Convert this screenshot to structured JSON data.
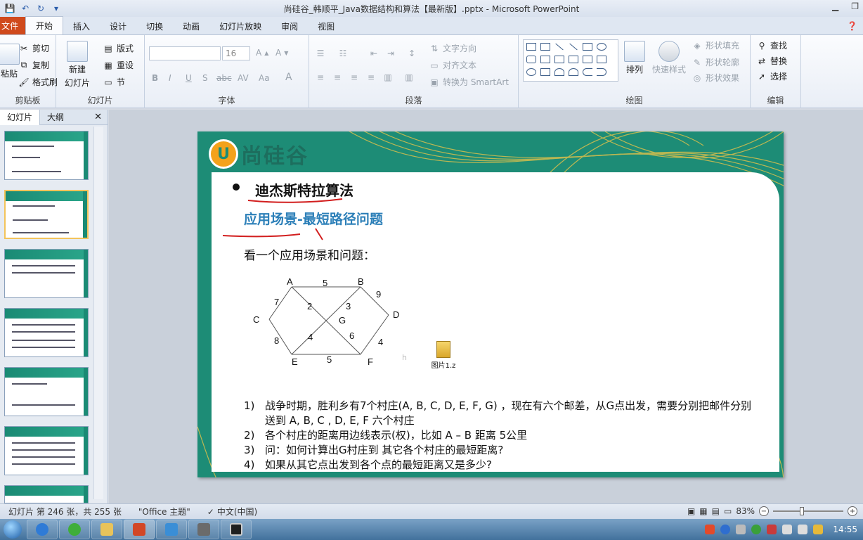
{
  "window": {
    "title": "尚硅谷_韩顺平_Java数据结构和算法【最新版】.pptx - Microsoft PowerPoint"
  },
  "tabs": [
    {
      "label": "文件"
    },
    {
      "label": "开始"
    },
    {
      "label": "插入"
    },
    {
      "label": "设计"
    },
    {
      "label": "切换"
    },
    {
      "label": "动画"
    },
    {
      "label": "幻灯片放映"
    },
    {
      "label": "审阅"
    },
    {
      "label": "视图"
    }
  ],
  "ribbon": {
    "clipboard": {
      "paste": "粘贴",
      "cut": "剪切",
      "copy": "复制",
      "format_painter": "格式刷",
      "label": "剪贴板"
    },
    "slides": {
      "new_slide": "新建",
      "new_slide_2": "幻灯片",
      "layout": "版式",
      "reset": "重设",
      "section": "节",
      "label": "幻灯片"
    },
    "font": {
      "size": "16",
      "bold": "B",
      "italic": "I",
      "underline": "U",
      "shadow": "S",
      "strike": "abc",
      "spacing": "AV",
      "case": "Aa",
      "grow": "A",
      "shrink": "A",
      "color": "A",
      "label": "字体"
    },
    "paragraph": {
      "text_direction": "文字方向",
      "align_text": "对齐文本",
      "smartart": "转换为 SmartArt",
      "label": "段落"
    },
    "drawing": {
      "arrange": "排列",
      "quick_styles": "快速样式",
      "shape_fill": "形状填充",
      "shape_outline": "形状轮廓",
      "shape_effects": "形状效果",
      "label": "绘图"
    },
    "editing": {
      "find": "查找",
      "replace": "替换",
      "select": "选择",
      "label": "编辑"
    }
  },
  "left_panel": {
    "tab_slides": "幻灯片",
    "tab_outline": "大纲"
  },
  "slide": {
    "logo_text": "尚硅谷",
    "title": "迪杰斯特拉算法",
    "subtitle": "应用场景-最短路径问题",
    "intro": "看一个应用场景和问题：",
    "file_label": "图片1.z",
    "faint_char": "h",
    "graph": {
      "nodes": [
        {
          "id": "A",
          "label": "A"
        },
        {
          "id": "B",
          "label": "B"
        },
        {
          "id": "C",
          "label": "C"
        },
        {
          "id": "D",
          "label": "D"
        },
        {
          "id": "E",
          "label": "E"
        },
        {
          "id": "F",
          "label": "F"
        },
        {
          "id": "G",
          "label": "G"
        }
      ],
      "edge_weights": [
        "5",
        "7",
        "2",
        "3",
        "9",
        "8",
        "4",
        "6",
        "4",
        "5"
      ]
    },
    "questions": [
      {
        "num": "1)",
        "text": "战争时期，胜利乡有7个村庄(A, B, C, D, E, F, G) ，现在有六个邮差，从G点出发，需要分别把邮件分别送到 A, B, C , D, E, F 六个村庄"
      },
      {
        "num": "2)",
        "text": "各个村庄的距离用边线表示(权)，比如 A – B 距离 5公里"
      },
      {
        "num": "3)",
        "text": "问：如何计算出G村庄到 其它各个村庄的最短距离?"
      },
      {
        "num": "4)",
        "text": "如果从其它点出发到各个点的最短距离又是多少?"
      }
    ]
  },
  "statusbar": {
    "slide_info": "幻灯片 第 246 张，共 255 张",
    "theme": "\"Office 主题\"",
    "language": "中文(中国)",
    "zoom": "83%",
    "zoom_fraction": 0.83
  },
  "taskbar": {
    "time": "14:55"
  },
  "colors": {
    "accent_teal": "#1d8c76",
    "file_tab": "#d04a1c",
    "subtitle_blue": "#2c7fb8",
    "annotation_red": "#d21e1e"
  }
}
